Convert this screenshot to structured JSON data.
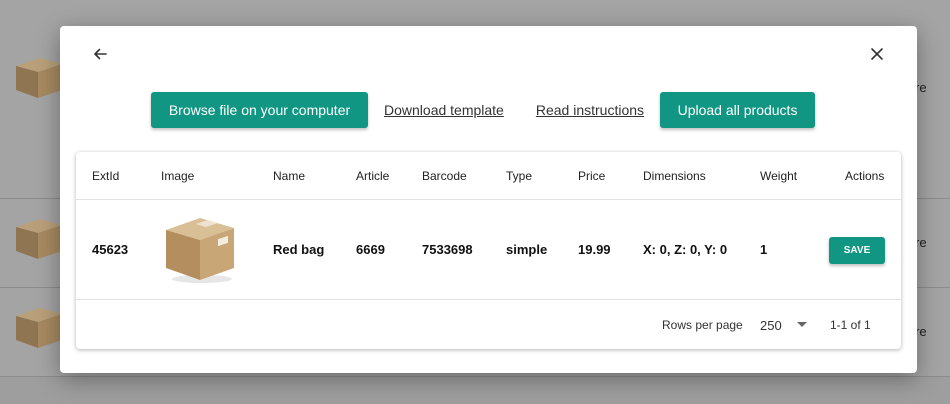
{
  "background": {
    "rows": [
      {
        "trailing_text": "re"
      },
      {
        "trailing_text": "re"
      },
      {
        "trailing_text": "re"
      }
    ]
  },
  "modal": {
    "icons": {
      "back": "arrow-left-icon",
      "close": "close-icon"
    },
    "toolbar": {
      "browse_label": "Browse file on your computer",
      "download_label": "Download template",
      "instructions_label": "Read instructions",
      "upload_label": "Upload all products"
    },
    "table": {
      "headers": {
        "extid": "ExtId",
        "image": "Image",
        "name": "Name",
        "article": "Article",
        "barcode": "Barcode",
        "type": "Type",
        "price": "Price",
        "dimensions": "Dimensions",
        "weight": "Weight",
        "actions": "Actions"
      },
      "rows": [
        {
          "extid": "45623",
          "image": "cardboard-box-image",
          "name": "Red bag",
          "article": "6669",
          "barcode": "7533698",
          "type": "simple",
          "price": "19.99",
          "dimensions": "X: 0, Z: 0, Y: 0",
          "weight": "1",
          "action_label": "SAVE"
        }
      ]
    },
    "pagination": {
      "rows_per_page_label": "Rows per page",
      "rows_per_page_value": "250",
      "range_text": "1-1 of 1"
    }
  },
  "colors": {
    "accent": "#119683",
    "overlay": "#9e9e9e"
  }
}
